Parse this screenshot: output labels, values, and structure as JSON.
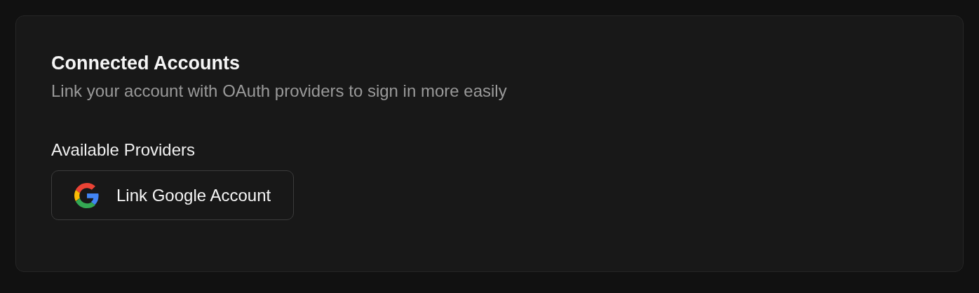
{
  "card": {
    "title": "Connected Accounts",
    "description": "Link your account with OAuth providers to sign in more easily",
    "section_title": "Available Providers",
    "providers": [
      {
        "kind": "google",
        "label": "Link Google Account"
      }
    ]
  }
}
